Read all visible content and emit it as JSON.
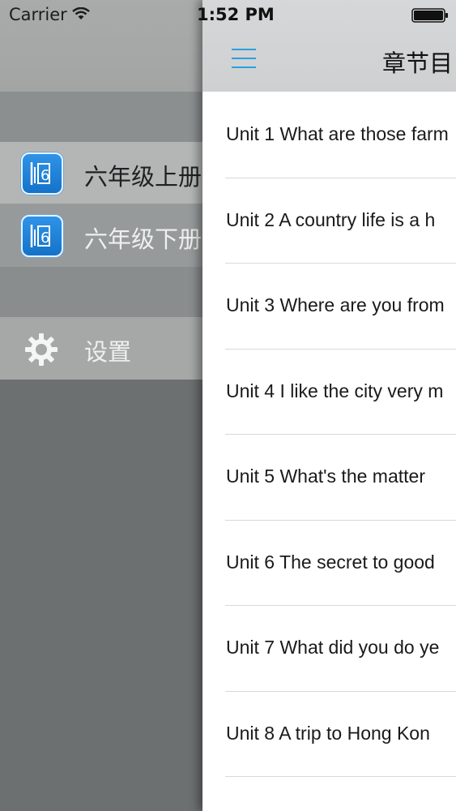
{
  "status_bar": {
    "carrier": "Carrier",
    "time": "1:52 PM"
  },
  "drawer": {
    "items": [
      {
        "label": "六年级上册",
        "icon": "book-app-icon"
      },
      {
        "label": "六年级下册",
        "icon": "book-app-icon"
      }
    ],
    "settings": {
      "label": "设置",
      "icon": "gear-icon"
    }
  },
  "main": {
    "title": "章节目",
    "chapters": [
      "Unit 1 What are those farm",
      "Unit 2 A country life is a h",
      "Unit 3 Where are you from",
      "Unit 4 I like the city very m",
      "Unit 5 What's the matter",
      "Unit 6 The secret to good",
      "Unit 7 What did you do ye",
      "Unit 8 A trip to Hong Kon"
    ]
  },
  "colors": {
    "accent": "#2b9fe0",
    "icon_blue": "#1f82d8"
  }
}
